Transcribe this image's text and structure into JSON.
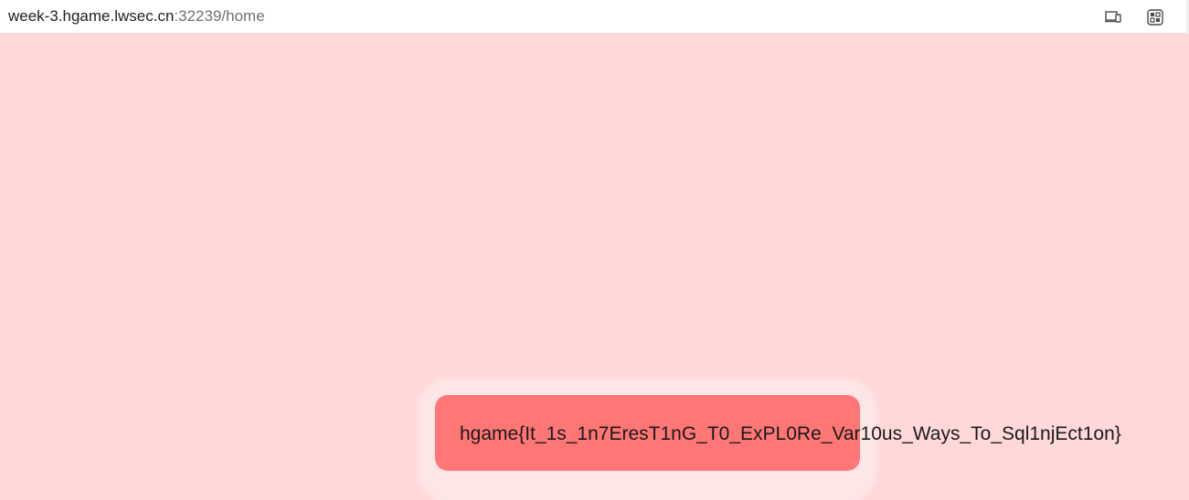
{
  "browser": {
    "url_host": "week-3.hgame.lwsec.cn",
    "url_rest": ":32239/home",
    "icons": [
      "device-icon",
      "extensions-icon"
    ]
  },
  "page": {
    "flag": "hgame{It_1s_1n7EresT1nG_T0_ExPL0Re_Var10us_Ways_To_Sql1njEct1on}"
  },
  "colors": {
    "background": "#ffd9d9",
    "flag_box": "#ff7676",
    "halo": "#ffe6e6"
  }
}
